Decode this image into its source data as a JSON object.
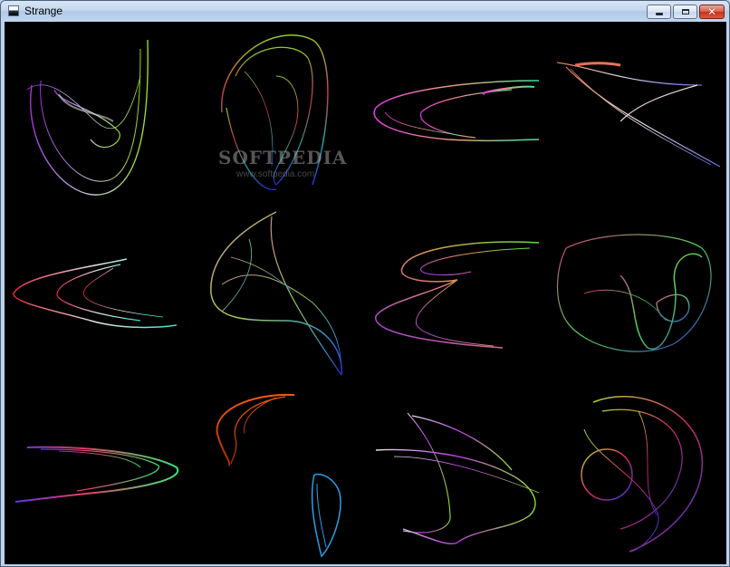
{
  "window": {
    "title": "Strange",
    "controls": {
      "minimize_glyph": "minimize-icon",
      "maximize_glyph": "maximize-icon",
      "close_glyph": "✕"
    }
  },
  "watermark": {
    "logo_text": "SOFTPEDIA",
    "url_text": "www.softpedia.com"
  },
  "gallery": {
    "grid": "4 columns x 3 rows",
    "count": 12
  },
  "colors": {
    "canvas_background": "#000000",
    "titlebar": "#c4d8ee",
    "close_button": "#c7321a"
  }
}
